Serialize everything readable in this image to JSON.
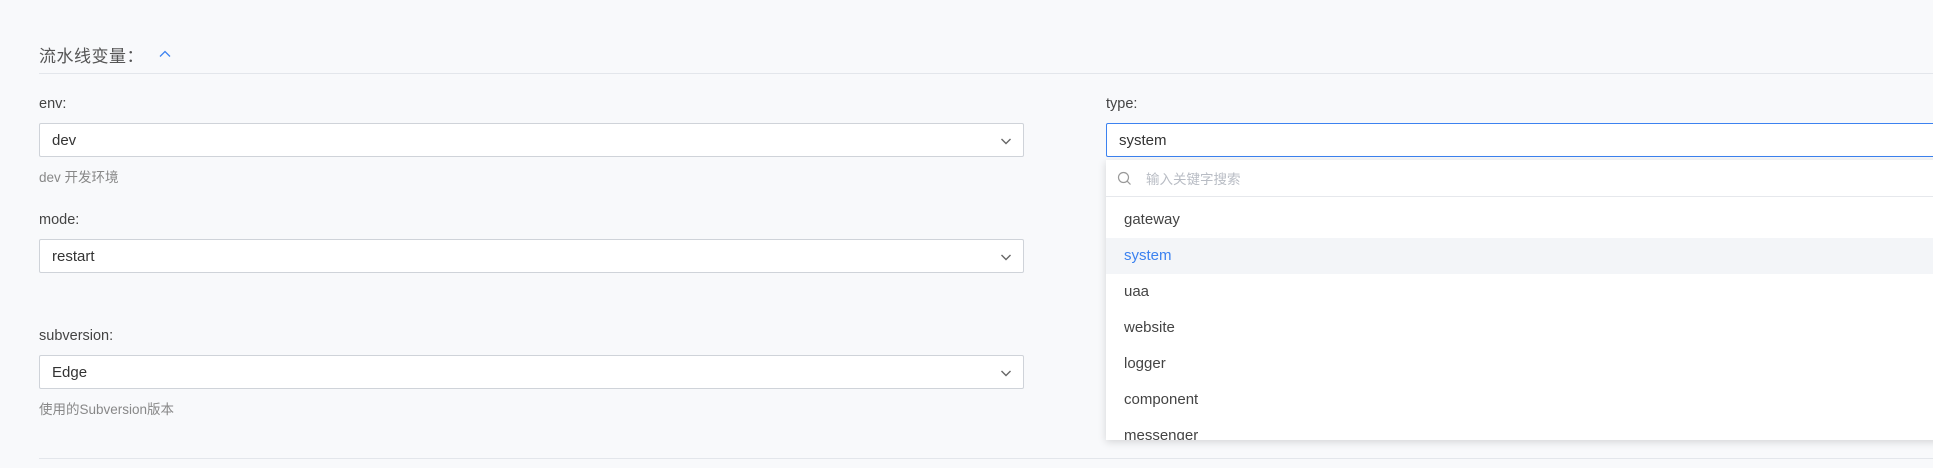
{
  "section": {
    "title": "流水线变量："
  },
  "fields": {
    "env": {
      "label": "env:",
      "value": "dev",
      "hint": "dev 开发环境"
    },
    "mode": {
      "label": "mode:",
      "value": "restart"
    },
    "subversion": {
      "label": "subversion:",
      "value": "Edge",
      "hint": "使用的Subversion版本"
    },
    "type": {
      "label": "type:",
      "value": "system"
    }
  },
  "dropdown": {
    "search_placeholder": "输入关键字搜索",
    "selected": "system",
    "options": [
      "gateway",
      "system",
      "uaa",
      "website",
      "logger",
      "component",
      "messenger"
    ]
  },
  "colors": {
    "accent": "#3c82f0",
    "border": "#cfd3d9",
    "background": "#f8f9fb"
  },
  "icons": {
    "collapse": "chevron-up-icon",
    "select_arrow": "chevron-down-icon",
    "search": "search-icon"
  }
}
